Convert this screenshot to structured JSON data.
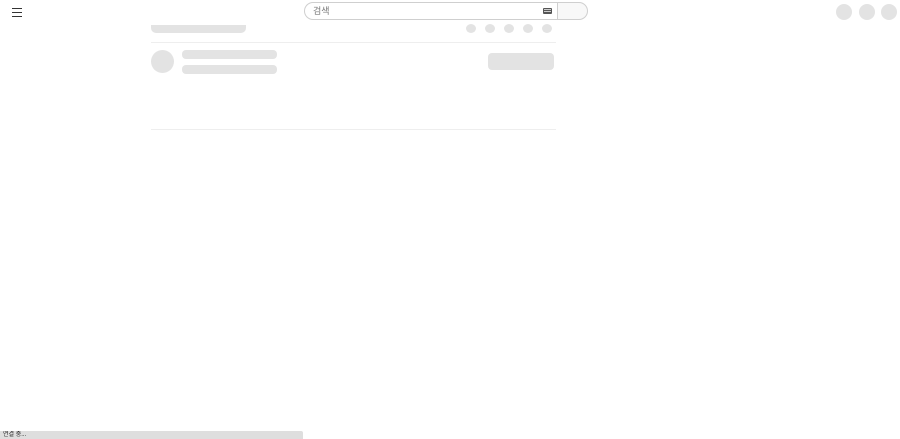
{
  "header": {
    "search": {
      "placeholder": "검색",
      "value": ""
    },
    "icons": {
      "menu": "menu-icon",
      "keyboard": "keyboard-icon"
    }
  },
  "status_bar": {
    "text": "연결 중..."
  },
  "colors": {
    "skeleton": "#e3e3e3",
    "divider": "#eeeeee",
    "status_bar": "#dedede"
  }
}
